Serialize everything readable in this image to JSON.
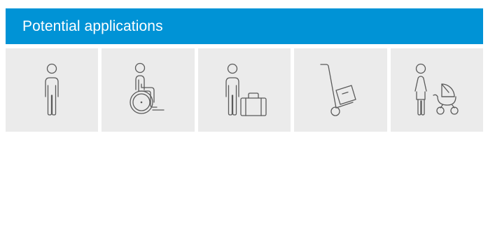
{
  "header": {
    "title": "Potential applications",
    "background_color": "#0093d6",
    "text_color": "#ffffff"
  },
  "tiles": [
    {
      "icon": "person-icon"
    },
    {
      "icon": "wheelchair-icon"
    },
    {
      "icon": "person-with-luggage-icon"
    },
    {
      "icon": "hand-truck-icon"
    },
    {
      "icon": "person-with-stroller-icon"
    }
  ],
  "tile_background_color": "#ebebeb",
  "icon_color": "#5a5a5a"
}
